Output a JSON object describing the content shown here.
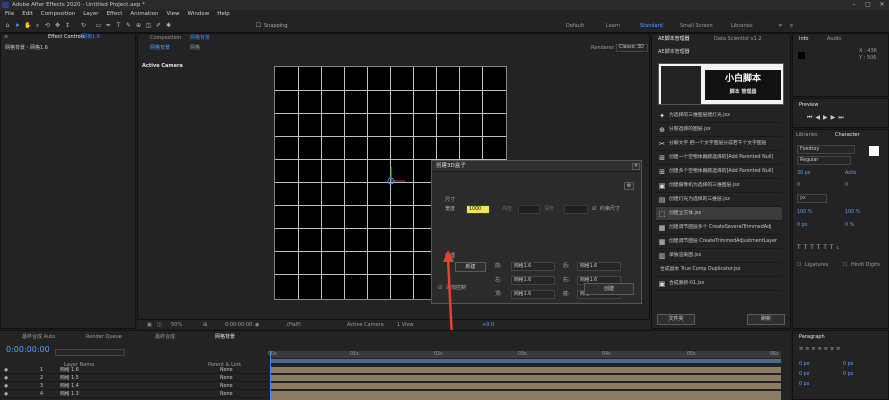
{
  "titlebar": {
    "title": "Adobe After Effects 2020 - Untitled Project.aep *"
  },
  "menu": [
    "File",
    "Edit",
    "Composition",
    "Layer",
    "Effect",
    "Animation",
    "View",
    "Window",
    "Help"
  ],
  "toolbar": {
    "snapping": "Snapping"
  },
  "workspaces": [
    "Default",
    "Learn",
    "Standard",
    "Small Screen",
    "Libraries"
  ],
  "project_panel": {
    "label": "网格背景・网格1.6"
  },
  "effect_controls": {
    "tab": "Effect Controls",
    "item": "网格1.6"
  },
  "composition": {
    "tab": "Composition",
    "comp_name": "网格背景",
    "tab2": "网格背景",
    "tab3": "网格",
    "renderer_label": "Renderer:",
    "renderer": "Classic 3D",
    "active_camera": "Active Camera",
    "footer": {
      "zoom": "50%",
      "timecode": "0:00:00:00",
      "resolution": "(Half)",
      "camera": "Active Camera",
      "views": "1 View",
      "offset": "+0.0"
    }
  },
  "dialog": {
    "title": "创建3D盒子",
    "size_label": "尺寸",
    "width_label": "宽度",
    "width_value": "1000",
    "height_label": "高度",
    "depth_label": "深度",
    "extra_label": "深度",
    "constrain_label": "约束尺寸",
    "texture_label": "纹理",
    "new_button": "新建",
    "faces": [
      {
        "label": "前:",
        "value": "网格1.6"
      },
      {
        "label": "后:",
        "value": "网格1.6"
      },
      {
        "label": "左:",
        "value": "网格1.6"
      },
      {
        "label": "右:",
        "value": "网格1.6"
      },
      {
        "label": "顶:",
        "value": "网格1.6"
      },
      {
        "label": "底:",
        "value": "网格1.6"
      }
    ],
    "control_label": "添加控制",
    "create_button": "创建"
  },
  "scripts_panel": {
    "tab": "AE脚本管理器",
    "tab2": "Data Scientist v1.2",
    "subtitle": "AE脚本管理器",
    "banner": "小白脚本",
    "banner_sub": "脚本 管理器",
    "items": [
      "为选择的三维图层建灯光.jsx",
      "分裂选择的图层.jsx",
      "分解文字 把一个文字图层分成若干个文字图层",
      "创建一个空物体跟踪选择的[Add Parented Null]",
      "创建多个空物体跟踪选择的[Add Parented Null]",
      "创建摄像机为选择的三维图层.jsx",
      "创建灯光为选择的三维层.jsx",
      "创建立方体.jsx",
      "创建调节图层多个 CreateSeveralTrimmedAdj",
      "创建调节图层 CreateTrimmedAdjustmentLayer",
      "单独渲染图.jsx",
      "合成副本 True Comp Duplicator.jsx",
      "合成重新-01.jsx"
    ],
    "folder_button": "文件夹",
    "refresh_button": "刷新"
  },
  "info_panel": {
    "tab": "Info",
    "tab2": "Audio",
    "x": "X : 436",
    "y": "Y : 506"
  },
  "preview_panel": {
    "tab": "Preview"
  },
  "character_panel": {
    "tab": "Libraries",
    "tab2": "Character",
    "font": "Foedroy",
    "style": "Regular",
    "size": "30 px",
    "leading": "Auto",
    "kerning": "0",
    "tracking": "0",
    "unit": "px",
    "vscale": "100 %",
    "hscale": "100 %",
    "baseline": "0 px",
    "tsume": "0 %",
    "ligatures": "Ligatures",
    "hindi": "Hindi Digits"
  },
  "paragraph_panel": {
    "tab": "Paragraph",
    "v1": "0 px",
    "v2": "0 px",
    "v3": "0 px",
    "v4": "0 px",
    "v5": "0 px"
  },
  "timeline": {
    "tabs": [
      "最终合成 Auto",
      "Render Queue",
      "最终合成",
      "网格背景"
    ],
    "timecode": "0:00:00:00",
    "columns": {
      "layer_name": "Layer Name",
      "parent": "Parent & Link"
    },
    "layers": [
      {
        "num": "1",
        "name": "网格 1.6",
        "parent": "None"
      },
      {
        "num": "2",
        "name": "网格 1.5",
        "parent": "None"
      },
      {
        "num": "3",
        "name": "网格 1.4",
        "parent": "None"
      },
      {
        "num": "4",
        "name": "网格 1.3",
        "parent": "None"
      }
    ],
    "ticks": [
      "00s",
      "01s",
      "02s",
      "03s",
      "04s",
      "05s",
      "06s"
    ]
  },
  "colors": {
    "accent": "#3c8cff",
    "arrow": "#e8402c",
    "track": "#8b7b60"
  }
}
